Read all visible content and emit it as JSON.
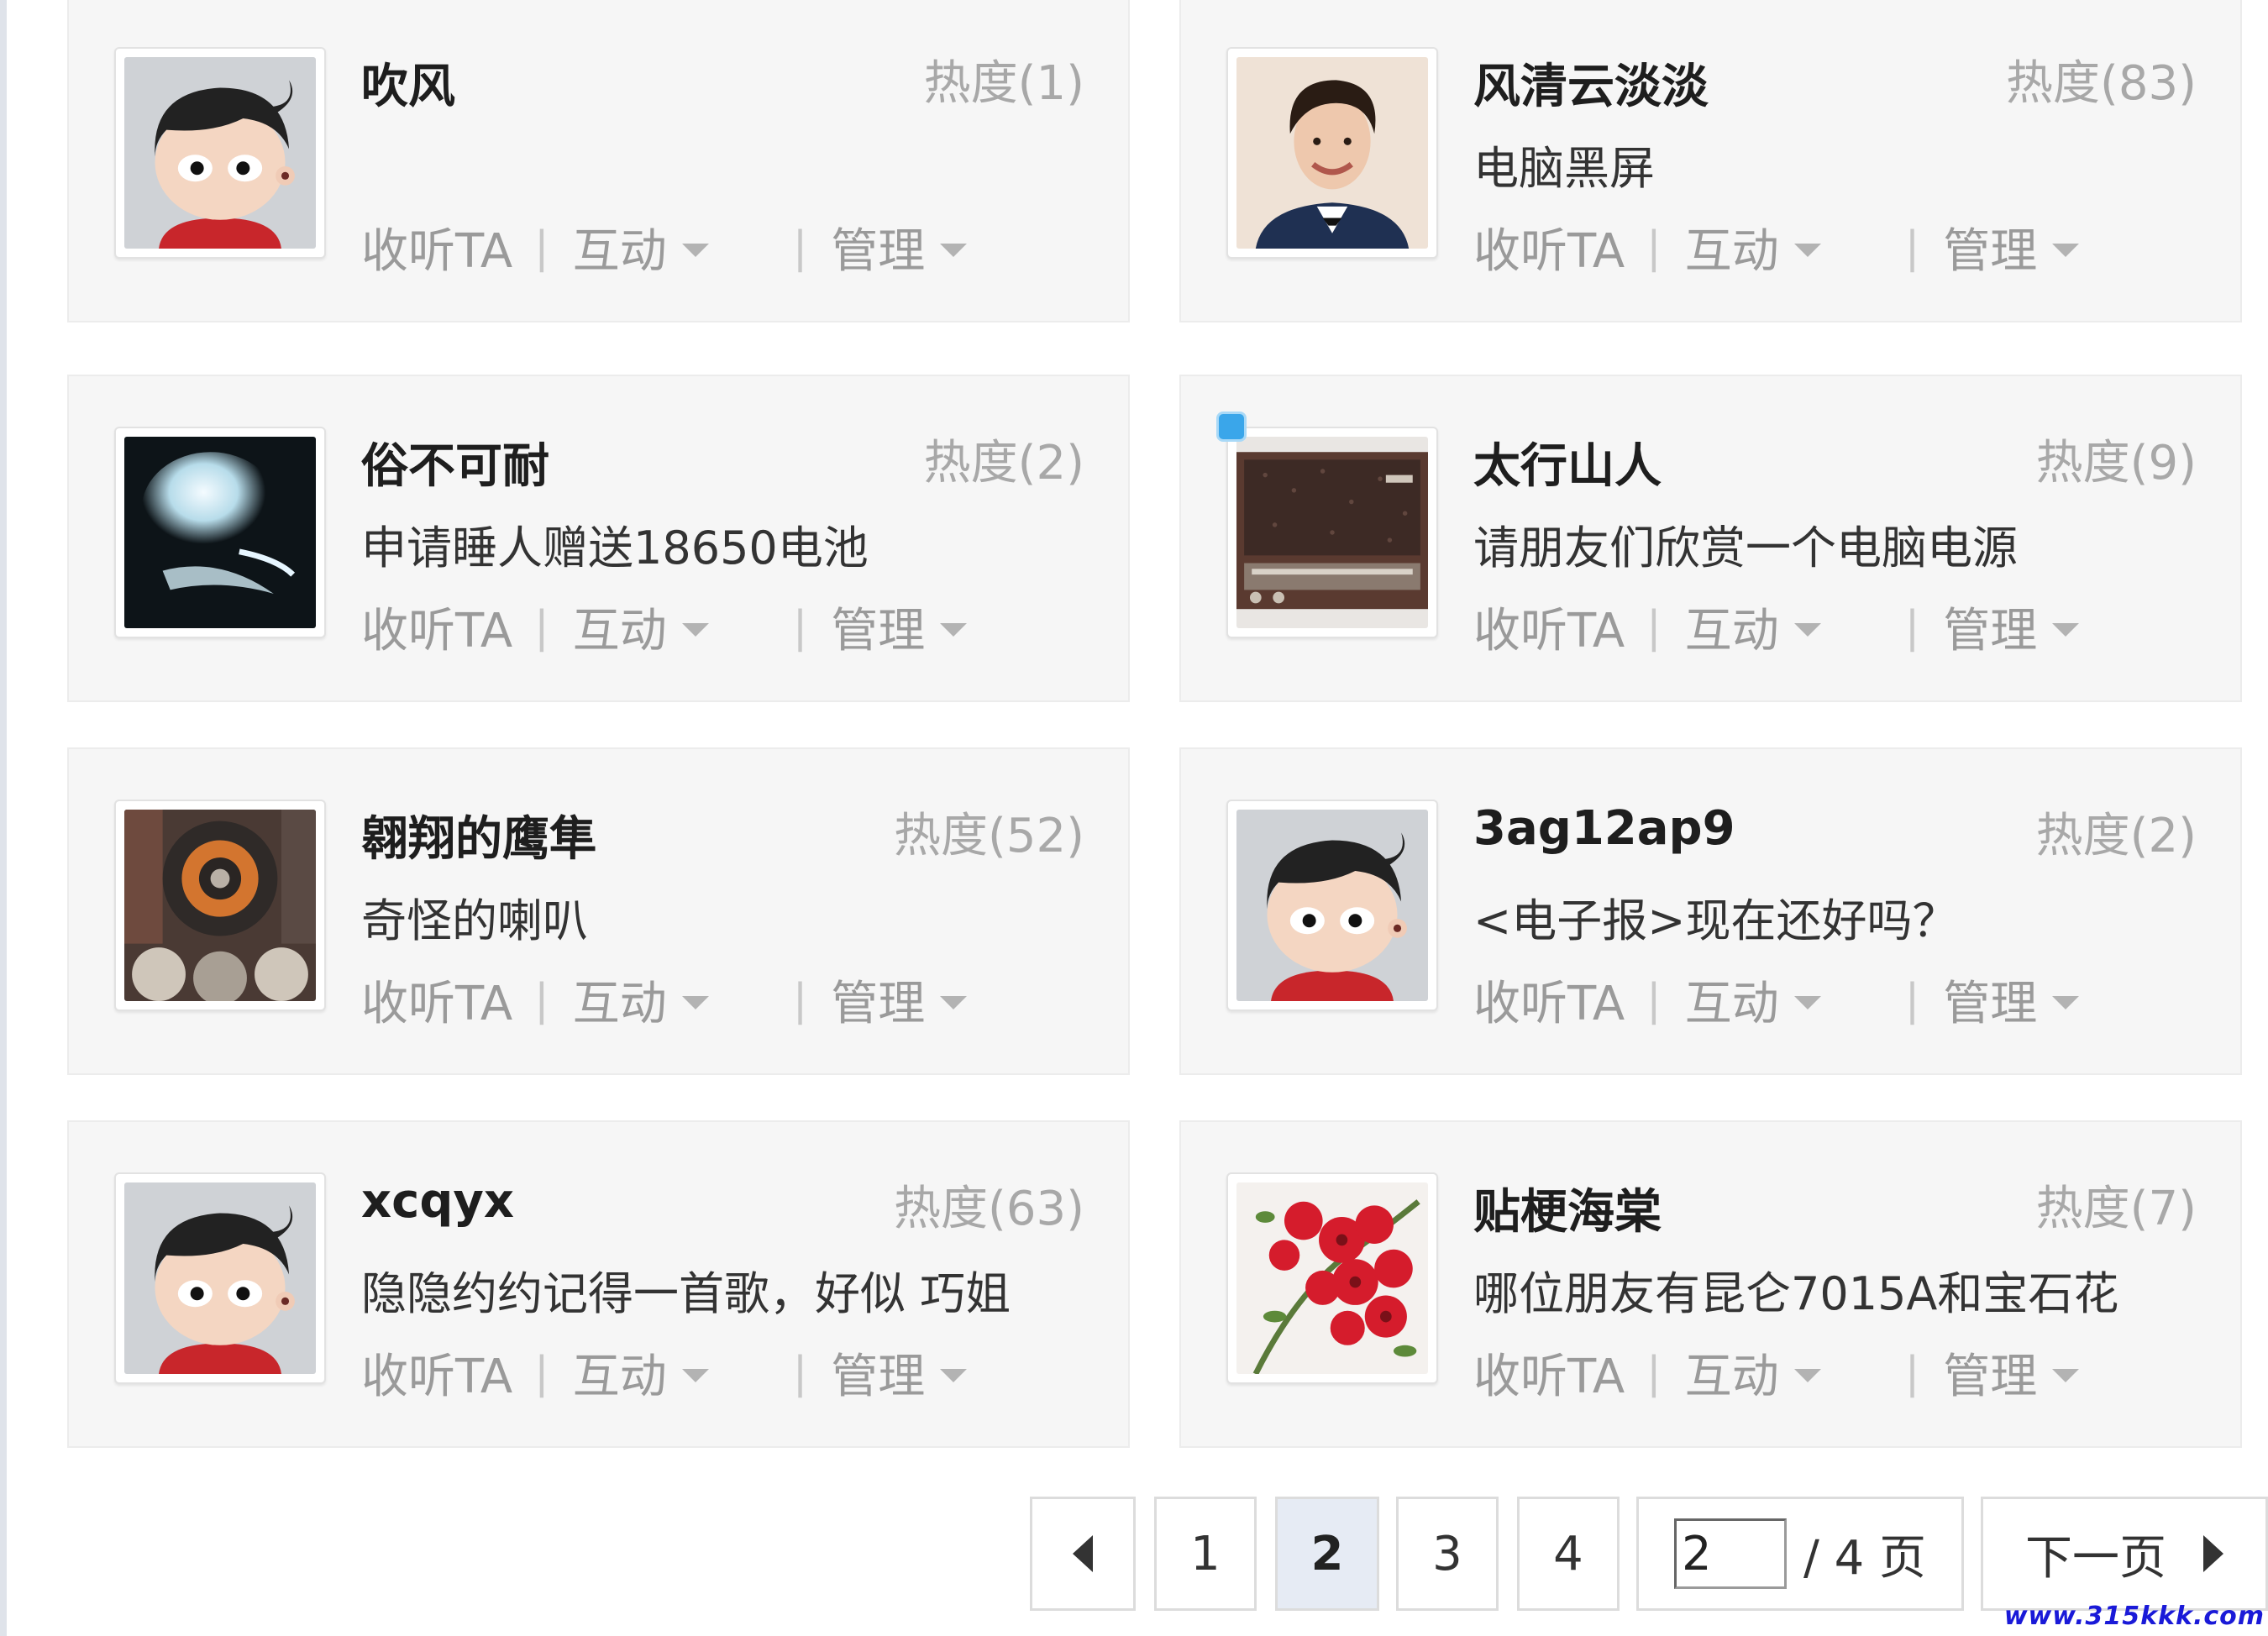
{
  "users": [
    {
      "name": "吹风",
      "heat": "热度(1)",
      "status": "",
      "avatar": "cartoon-avatar",
      "badge": false
    },
    {
      "name": "风清云淡淡",
      "heat": "热度(83)",
      "status": "电脑黑屏",
      "avatar": "portrait-photo",
      "badge": false
    },
    {
      "name": "俗不可耐",
      "heat": "热度(2)",
      "status": "申请睡人赠送18650电池",
      "avatar": "glow-silhouette",
      "badge": false
    },
    {
      "name": "太行山人",
      "heat": "热度(9)",
      "status": "请朋友们欣赏一个电脑电源",
      "avatar": "vintage-radio",
      "badge": true
    },
    {
      "name": "翱翔的鹰隼",
      "heat": "热度(52)",
      "status": "奇怪的喇叭",
      "avatar": "speaker-photo",
      "badge": false
    },
    {
      "name": "3ag12ap9",
      "heat": "热度(2)",
      "status": "<电子报>现在还好吗？",
      "avatar": "cartoon-avatar",
      "badge": false
    },
    {
      "name": "xcqyx",
      "heat": "热度(63)",
      "status": "隐隐约约记得一首歌，好似 巧姐",
      "avatar": "cartoon-avatar",
      "badge": false
    },
    {
      "name": "贴梗海棠",
      "heat": "热度(7)",
      "status": "哪位朋友有昆仑7015A和宝石花",
      "avatar": "red-flowers",
      "badge": false
    }
  ],
  "actions": {
    "listen": "收听TA",
    "interact": "互动",
    "manage": "管理",
    "separator": "|"
  },
  "pagination": {
    "pages": [
      "1",
      "2",
      "3",
      "4"
    ],
    "current": "2",
    "input_value": "2",
    "of_total": "/ 4 页",
    "next_label": "下一页"
  },
  "watermark": "www.315kkk.com",
  "colors": {
    "card_bg": "#f6f6f6",
    "heat": "#a8a8a8",
    "action": "#9a9a9a",
    "active_page": "#e6ebf4",
    "watermark": "#1a1ad8"
  }
}
